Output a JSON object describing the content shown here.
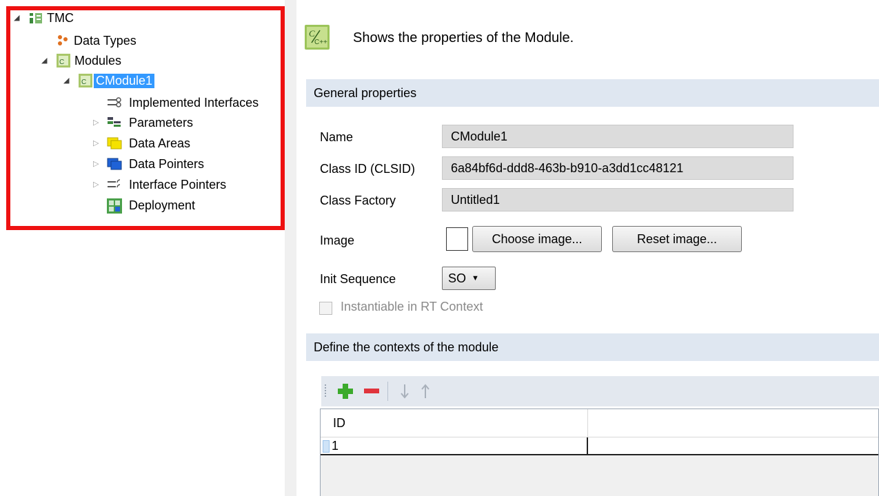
{
  "tree": {
    "root": {
      "label": "TMC"
    },
    "items": [
      {
        "label": "Data Types"
      },
      {
        "label": "Modules"
      },
      {
        "label": "CModule1"
      },
      {
        "label": "Implemented Interfaces"
      },
      {
        "label": "Parameters"
      },
      {
        "label": "Data Areas"
      },
      {
        "label": "Data Pointers"
      },
      {
        "label": "Interface Pointers"
      },
      {
        "label": "Deployment"
      }
    ],
    "highlight_color": "#ee1111",
    "selection_color": "#3399ff"
  },
  "panel": {
    "header_text": "Shows the properties of the Module.",
    "general_section": "General properties",
    "fields": {
      "name_label": "Name",
      "name_value": "CModule1",
      "clsid_label": "Class ID (CLSID)",
      "clsid_value": "6a84bf6d-ddd8-463b-b910-a3dd1cc48121",
      "factory_label": "Class Factory",
      "factory_value": "Untitled1",
      "image_label": "Image",
      "choose_image": "Choose image...",
      "reset_image": "Reset image...",
      "init_label": "Init Sequence",
      "init_value": "SO",
      "instantiable_label": "Instantiable in RT Context",
      "instantiable_checked": false
    },
    "contexts_section": "Define the contexts of the module",
    "grid": {
      "columns": [
        "ID",
        ""
      ],
      "rows": [
        [
          "1",
          ""
        ]
      ]
    },
    "section_color": "#dfe7f1"
  }
}
